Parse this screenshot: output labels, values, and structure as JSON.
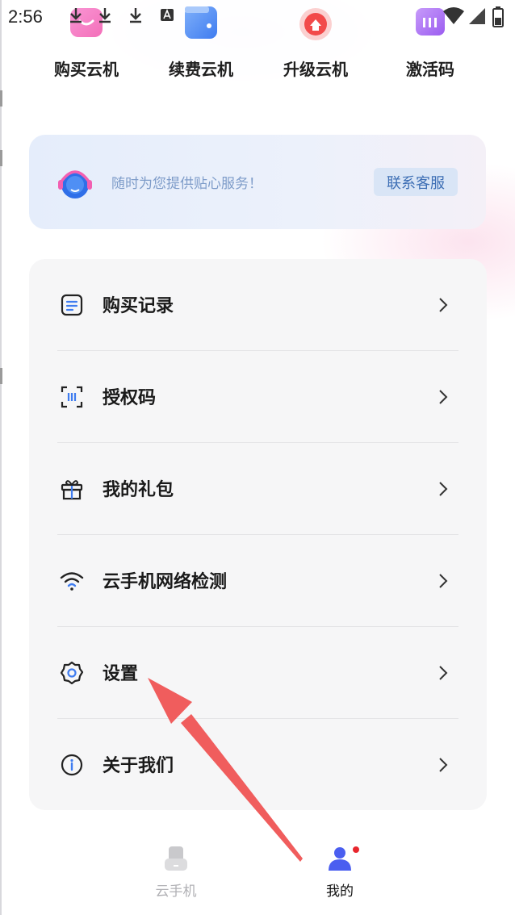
{
  "status_bar": {
    "time": "2:56"
  },
  "quick_actions": [
    {
      "label": "购买云机",
      "icon": "cart-icon",
      "color": "#f25fb1"
    },
    {
      "label": "续费云机",
      "icon": "wallet-icon",
      "color": "#3f7cf0"
    },
    {
      "label": "升级云机",
      "icon": "upgrade-icon",
      "color": "#f24a4a"
    },
    {
      "label": "激活码",
      "icon": "code-icon",
      "color": "#9b5cf0"
    }
  ],
  "service": {
    "text": "随时为您提供贴心服务！",
    "button": "联系客服"
  },
  "menu": [
    {
      "label": "购买记录",
      "icon": "document-list-icon"
    },
    {
      "label": "授权码",
      "icon": "scan-code-icon"
    },
    {
      "label": "我的礼包",
      "icon": "gift-icon"
    },
    {
      "label": "云手机网络检测",
      "icon": "wifi-icon"
    },
    {
      "label": "设置",
      "icon": "gear-icon"
    },
    {
      "label": "关于我们",
      "icon": "info-icon"
    }
  ],
  "bottom_nav": [
    {
      "label": "云手机",
      "icon": "phone-icon",
      "active": false
    },
    {
      "label": "我的",
      "icon": "user-icon",
      "active": true,
      "badge": true
    }
  ],
  "colors": {
    "accent": "#4a5ef0",
    "badge": "#e8262d",
    "annotation_arrow": "#f05d5d"
  }
}
